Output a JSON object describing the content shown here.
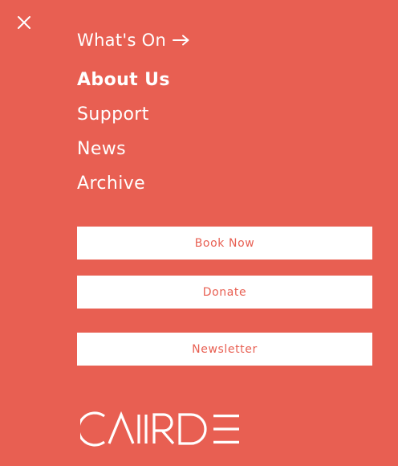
{
  "menu": {
    "close_icon": "close-icon",
    "whats_on_label": "What's On",
    "whats_on_icon": "arrow-right-icon",
    "items": [
      {
        "label": "About Us",
        "active": true
      },
      {
        "label": "Support",
        "active": false
      },
      {
        "label": "News",
        "active": false
      },
      {
        "label": "Archive",
        "active": false
      }
    ]
  },
  "buttons": {
    "book_now": "Book Now",
    "donate": "Donate",
    "newsletter": "Newsletter"
  },
  "logo": {
    "text": "CAIRDE"
  },
  "colors": {
    "background": "#e85f52",
    "foreground": "#ffffff",
    "button_text": "#e85f52"
  }
}
